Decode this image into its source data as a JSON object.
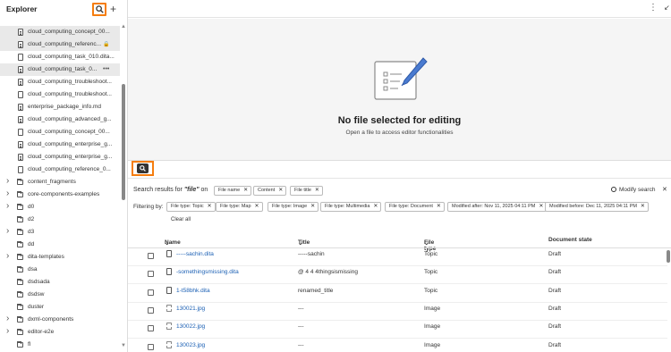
{
  "explorer": {
    "title": "Explorer",
    "files": [
      {
        "name": "cloud_computing_concept_00...",
        "selected": true,
        "trail": ""
      },
      {
        "name": "cloud_computing_referenc...",
        "selected": true,
        "trail": "lock"
      },
      {
        "name": "cloud_computing_task_010.dita...",
        "selected": false,
        "trail": ""
      },
      {
        "name": "cloud_computing_task_0...",
        "selected": true,
        "trail": "•••"
      },
      {
        "name": "cloud_computing_troubleshoot...",
        "selected": false,
        "trail": ""
      },
      {
        "name": "cloud_computing_troubleshoot...",
        "selected": false,
        "trail": ""
      },
      {
        "name": "enterprise_package_info.md",
        "selected": false,
        "trail": ""
      },
      {
        "name": "cloud_computing_advanced_g...",
        "selected": false,
        "trail": ""
      },
      {
        "name": "cloud_computing_concept_00...",
        "selected": false,
        "trail": ""
      },
      {
        "name": "cloud_computing_enterprise_g...",
        "selected": false,
        "trail": ""
      },
      {
        "name": "cloud_computing_enterprise_g...",
        "selected": false,
        "trail": ""
      },
      {
        "name": "cloud_computing_reference_0...",
        "selected": false,
        "trail": ""
      }
    ],
    "folders": [
      {
        "name": "content_fragments",
        "expandable": true
      },
      {
        "name": "core-components-examples",
        "expandable": true
      },
      {
        "name": "d0",
        "expandable": true
      },
      {
        "name": "d2",
        "expandable": false
      },
      {
        "name": "d3",
        "expandable": true
      },
      {
        "name": "dd",
        "expandable": false
      },
      {
        "name": "dita-templates",
        "expandable": true
      },
      {
        "name": "dsa",
        "expandable": false
      },
      {
        "name": "dsdsada",
        "expandable": false
      },
      {
        "name": "dsdsw",
        "expandable": false
      },
      {
        "name": "duster",
        "expandable": false
      },
      {
        "name": "dxml-components",
        "expandable": true
      },
      {
        "name": "editor-e2e",
        "expandable": true
      },
      {
        "name": "fl",
        "expandable": false
      }
    ]
  },
  "empty_state": {
    "title": "No file selected for editing",
    "subtitle": "Open a file to access editor functionalities"
  },
  "search": {
    "results_prefix": "Search results for",
    "query": "\"file\"",
    "on_word": "on",
    "scope_chips": [
      "File name",
      "Content",
      "File title"
    ],
    "modify_label": "Modify search",
    "filtering_label": "Filtering by:",
    "filter_chips": [
      "File type: Topic",
      "File type: Map",
      "File type: Image",
      "File type: Multimedia",
      "File type: Document",
      "Modified after: Nov 11, 2025 04:11 PM",
      "Modified before: Dec 11, 2025 04:11 PM"
    ],
    "clear_all": "Clear all"
  },
  "table": {
    "headers": {
      "name": "Name",
      "title": "Title",
      "type": "File type",
      "state": "Document state"
    },
    "rows": [
      {
        "name": "-----sachin.dita",
        "title": "-----sachin",
        "type": "Topic",
        "state": "Draft",
        "icon": "doc"
      },
      {
        "name": "-somethingsmissing.dita",
        "title": "@ 4 4 4thingsismissing",
        "type": "Topic",
        "state": "Draft",
        "icon": "doc"
      },
      {
        "name": "1-t58bhk.dita",
        "title": "renamed_title",
        "type": "Topic",
        "state": "Draft",
        "icon": "doc"
      },
      {
        "name": "130021.jpg",
        "title": "---",
        "type": "Image",
        "state": "Draft",
        "icon": "image"
      },
      {
        "name": "130022.jpg",
        "title": "---",
        "type": "Image",
        "state": "Draft",
        "icon": "image"
      },
      {
        "name": "130023.jpg",
        "title": "---",
        "type": "Image",
        "state": "Draft",
        "icon": "image"
      }
    ]
  },
  "colors": {
    "highlight": "#f57d0e",
    "link": "#1a5fb4",
    "accent": "#4a7bd0"
  }
}
